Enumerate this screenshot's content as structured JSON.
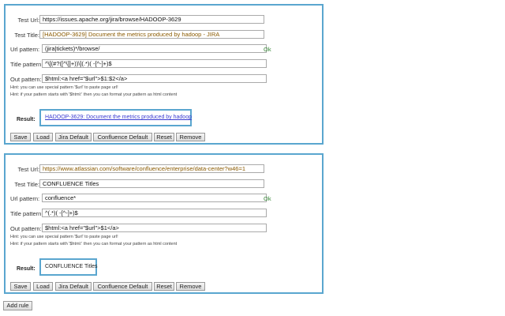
{
  "labels": {
    "test_url": "Test Url:",
    "test_title": "Test Title:",
    "url_pattern": "Url pattern:",
    "title_pattern": "Title pattern:",
    "out_pattern": "Out pattern:",
    "result": "Result:",
    "ok": "Ok",
    "hint1": "Hint: you can use special pattern '$url' to paste page url!",
    "hint2": "Hint: if your pattern starts with '$html:' then you can format your pattern as html content"
  },
  "buttons": {
    "save": "Save",
    "load": "Load",
    "jira": "Jira Default",
    "confluence": "Confluence Default",
    "reset": "Reset",
    "remove": "Remove",
    "add_rule": "Add rule"
  },
  "rules": [
    {
      "test_url": "https://issues.apache.org/jira/browse/HADOOP-3629",
      "test_title": "[HADOOP-3629] Document the metrics produced by hadoop - JIRA",
      "url_pattern": "(jira|tickets)*/browse/",
      "title_pattern": "^\\[(#?([^\\]]+))\\](.*)( -[^-]+)$",
      "out_pattern": "$html:<a href=\"$url\">$1:$2</a>",
      "result": "HADOOP-3629: Document the metrics produced by hadoop"
    },
    {
      "test_url": "https://www.atlassian.com/software/confluence/enterprise/data-center?w46=1",
      "test_title": "CONFLUENCE Titles",
      "url_pattern": "confluence*",
      "title_pattern": "^(.*)( -[^-]+)$",
      "out_pattern": "$html:<a href=\"$url\">$1</a>",
      "result": "CONFLUENCE Titles"
    }
  ]
}
